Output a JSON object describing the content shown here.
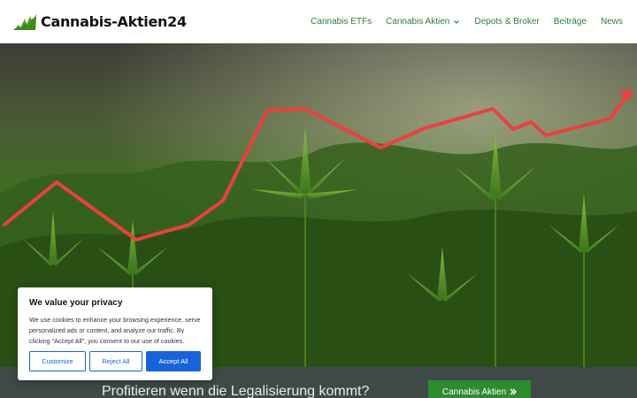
{
  "site": {
    "logo_icon": "cannabis-leaf-logo-icon",
    "title": "Cannabis-Aktien24"
  },
  "nav": {
    "items": [
      {
        "label": "Cannabis ETFs"
      },
      {
        "label": "Cannabis Aktien",
        "has_dropdown": true
      },
      {
        "label": "Depots & Broker"
      },
      {
        "label": "Beiträge"
      },
      {
        "label": "News"
      }
    ]
  },
  "hero": {
    "image": "cannabis-plants-with-rising-stock-chart",
    "trend_line_color": "#e8413f"
  },
  "cookie": {
    "title": "We value your privacy",
    "text": "We use cookies to enhance your browsing experience, serve personalized ads or content, and analyze our traffic. By clicking \"Accept All\", you consent to our use of cookies.",
    "customize": "Customize",
    "reject": "Reject All",
    "accept": "Accept All"
  },
  "band": {
    "text": "Profitieren wenn die Legalisierung kommt?",
    "cta": "Cannabis Aktien",
    "cta_icon": "double-chevron-right-icon"
  },
  "colors": {
    "accent_green": "#2e7d32",
    "cta_green": "#2e8b2e",
    "cookie_blue": "#1863dc",
    "band_bg": "#3f4a48"
  }
}
